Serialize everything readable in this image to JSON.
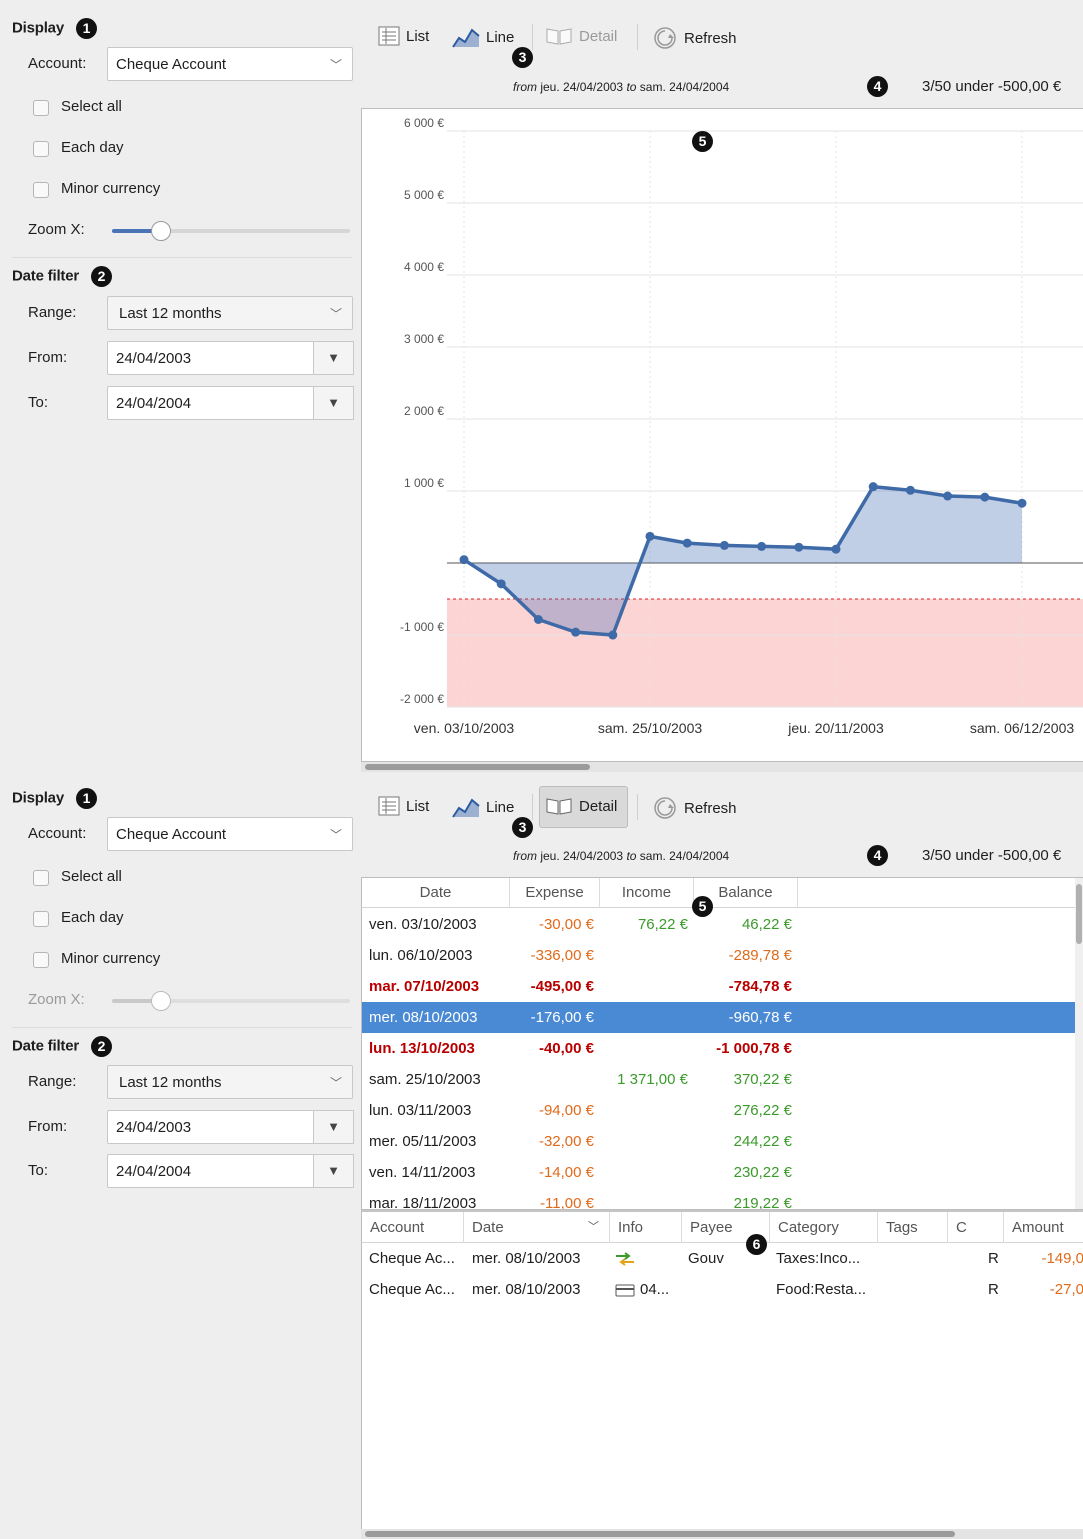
{
  "badges": {
    "display": "1",
    "date_filter": "2",
    "toolbar": "3",
    "under": "4",
    "chart": "5",
    "operations": "6"
  },
  "display": {
    "title": "Display",
    "account_label": "Account:",
    "account_value": "Cheque Account",
    "select_all": "Select all",
    "each_day": "Each day",
    "minor_currency": "Minor currency",
    "zoom_label": "Zoom X:",
    "zoom_level": 0.19
  },
  "date_filter": {
    "title": "Date filter",
    "range_label": "Range:",
    "range_value": "Last 12 months",
    "from_label": "From:",
    "from_value": "24/04/2003",
    "to_label": "To:",
    "to_value": "24/04/2004"
  },
  "toolbar": {
    "list": "List",
    "line": "Line",
    "detail": "Detail",
    "refresh": "Refresh"
  },
  "range_text": {
    "from_word": "from",
    "from_date": "jeu. 24/04/2003",
    "to_word": "to",
    "to_date": "sam. 24/04/2004"
  },
  "under_text": "3/50 under -500,00 €",
  "colors": {
    "accent": "#4a74b6",
    "selection": "#4a8ad4",
    "expense": "#e06a1b",
    "income": "#3a9a2a",
    "warning": "#b80000",
    "zone_fill": "#fdd4d4"
  },
  "chart_data": {
    "type": "line",
    "title": "",
    "xlabel": "",
    "ylabel": "",
    "ylim": [
      -2000,
      6000
    ],
    "yticks": [
      "6 000 €",
      "5 000 €",
      "4 000 €",
      "3 000 €",
      "2 000 €",
      "1 000 €",
      "-1 000 €",
      "-2 000 €"
    ],
    "ytick_values": [
      6000,
      5000,
      4000,
      3000,
      2000,
      1000,
      -1000,
      -2000
    ],
    "xticks": [
      "ven. 03/10/2003",
      "sam. 25/10/2003",
      "jeu. 20/11/2003",
      "sam. 06/12/2003"
    ],
    "xtick_index": [
      0,
      5,
      10,
      15
    ],
    "threshold": -500,
    "series": [
      {
        "values": [
          46.22,
          -289.78,
          -784.78,
          -960.78,
          -1000.78,
          370.22,
          276.22,
          244.22,
          230.22,
          219.22,
          192,
          1060,
          1010,
          930,
          915,
          830
        ]
      }
    ]
  },
  "table": {
    "headers": [
      "Date",
      "Expense",
      "Income",
      "Balance"
    ],
    "rows": [
      {
        "date": "ven. 03/10/2003",
        "expense": "-30,00 €",
        "income": "76,22 €",
        "balance": "46,22 €",
        "style": ""
      },
      {
        "date": "lun. 06/10/2003",
        "expense": "-336,00 €",
        "income": "",
        "balance": "-289,78 €",
        "style": ""
      },
      {
        "date": "mar. 07/10/2003",
        "expense": "-495,00 €",
        "income": "",
        "balance": "-784,78 €",
        "style": "red"
      },
      {
        "date": "mer. 08/10/2003",
        "expense": "-176,00 €",
        "income": "",
        "balance": "-960,78 €",
        "style": "sel"
      },
      {
        "date": "lun. 13/10/2003",
        "expense": "-40,00 €",
        "income": "",
        "balance": "-1 000,78 €",
        "style": "red"
      },
      {
        "date": "sam. 25/10/2003",
        "expense": "",
        "income": "1 371,00 €",
        "balance": "370,22 €",
        "style": ""
      },
      {
        "date": "lun. 03/11/2003",
        "expense": "-94,00 €",
        "income": "",
        "balance": "276,22 €",
        "style": ""
      },
      {
        "date": "mer. 05/11/2003",
        "expense": "-32,00 €",
        "income": "",
        "balance": "244,22 €",
        "style": ""
      },
      {
        "date": "ven. 14/11/2003",
        "expense": "-14,00 €",
        "income": "",
        "balance": "230,22 €",
        "style": ""
      },
      {
        "date": "mar. 18/11/2003",
        "expense": "-11,00 €",
        "income": "",
        "balance": "219,22 €",
        "style": ""
      }
    ]
  },
  "operations": {
    "headers": [
      "Account",
      "Date",
      "Info",
      "Payee",
      "Category",
      "Tags",
      "C",
      "Amount"
    ],
    "rows": [
      {
        "account": "Cheque Ac...",
        "date": "mer. 08/10/2003",
        "info": "",
        "info_icon": "transfer-icon",
        "payee": "Gouv",
        "category": "Taxes:Inco...",
        "tags": "",
        "c": "R",
        "amount": "-149,0"
      },
      {
        "account": "Cheque Ac...",
        "date": "mer. 08/10/2003",
        "info": "04...",
        "info_icon": "card-icon",
        "payee": "",
        "category": "Food:Resta...",
        "tags": "",
        "c": "R",
        "amount": "-27,0"
      }
    ]
  }
}
